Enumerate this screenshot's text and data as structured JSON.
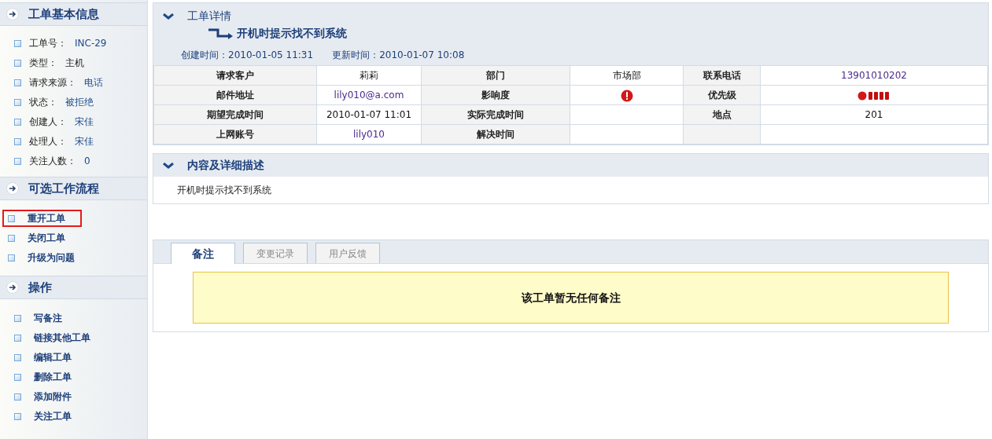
{
  "sidebar": {
    "info": {
      "title": "工单基本信息",
      "items": [
        {
          "label": "工单号：",
          "value": "INC-29",
          "link": true
        },
        {
          "label": "类型：",
          "value": "主机",
          "link": false
        },
        {
          "label": "请求来源：",
          "value": "电话",
          "link": true
        },
        {
          "label": "状态：",
          "value": "被拒绝",
          "link": true
        },
        {
          "label": "创建人：",
          "value": "宋佳",
          "link": true
        },
        {
          "label": "处理人：",
          "value": "宋佳",
          "link": true
        },
        {
          "label": "关注人数：",
          "value": "0",
          "link": true
        }
      ]
    },
    "workflow": {
      "title": "可选工作流程",
      "items": [
        {
          "label": "重开工单",
          "highlighted": true
        },
        {
          "label": "关闭工单",
          "highlighted": false
        },
        {
          "label": "升级为问题",
          "highlighted": false
        }
      ]
    },
    "operations": {
      "title": "操作",
      "items": [
        "写备注",
        "链接其他工单",
        "编辑工单",
        "删除工单",
        "添加附件",
        "关注工单"
      ]
    }
  },
  "details": {
    "title": "工单详情",
    "subject": "开机时提示找不到系统",
    "created_label": "创建时间：",
    "created": "2010-01-05 11:31",
    "updated_label": "更新时间：",
    "updated": "2010-01-07 10:08",
    "rows": [
      [
        {
          "kind": "label",
          "text": "请求客户"
        },
        {
          "kind": "text",
          "text": "莉莉"
        },
        {
          "kind": "label",
          "text": "部门"
        },
        {
          "kind": "text",
          "text": "市场部"
        },
        {
          "kind": "label",
          "text": "联系电话"
        },
        {
          "kind": "link",
          "text": "13901010202"
        }
      ],
      [
        {
          "kind": "label",
          "text": "邮件地址"
        },
        {
          "kind": "link",
          "text": "lily010@a.com"
        },
        {
          "kind": "label",
          "text": "影响度"
        },
        {
          "kind": "impact_icon"
        },
        {
          "kind": "label",
          "text": "优先级"
        },
        {
          "kind": "priority_icon"
        }
      ],
      [
        {
          "kind": "label",
          "text": "期望完成时间"
        },
        {
          "kind": "text",
          "text": "2010-01-07 11:01"
        },
        {
          "kind": "label",
          "text": "实际完成时间"
        },
        {
          "kind": "empty"
        },
        {
          "kind": "label",
          "text": "地点"
        },
        {
          "kind": "text",
          "text": "201"
        }
      ],
      [
        {
          "kind": "label",
          "text": "上网账号"
        },
        {
          "kind": "link",
          "text": "lily010"
        },
        {
          "kind": "label",
          "text": "解决时间"
        },
        {
          "kind": "empty"
        },
        {
          "kind": "label_empty"
        },
        {
          "kind": "empty"
        }
      ]
    ]
  },
  "description": {
    "title": "内容及详细描述",
    "text": "开机时提示找不到系统"
  },
  "notes": {
    "tabs": [
      {
        "label": "备注",
        "selected": true
      },
      {
        "label": "变更记录",
        "selected": false
      },
      {
        "label": "用户反馈",
        "selected": false
      }
    ],
    "empty_message": "该工单暂无任何备注"
  }
}
